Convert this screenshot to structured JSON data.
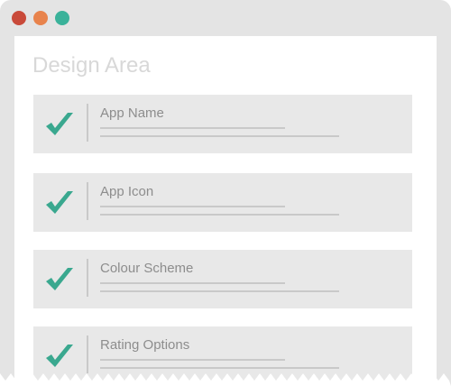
{
  "window": {
    "controls": [
      {
        "name": "close",
        "color": "#c94a3a"
      },
      {
        "name": "minimize",
        "color": "#e8834c"
      },
      {
        "name": "maximize",
        "color": "#3ab29a"
      }
    ]
  },
  "page": {
    "title": "Design Area"
  },
  "checklist": {
    "check_icon": "checkmark-icon",
    "check_color": "#3aa88f",
    "items": [
      {
        "label": "App Name",
        "checked": true
      },
      {
        "label": "App Icon",
        "checked": true
      },
      {
        "label": "Colour Scheme",
        "checked": true
      },
      {
        "label": "Rating Options",
        "checked": true
      }
    ]
  }
}
